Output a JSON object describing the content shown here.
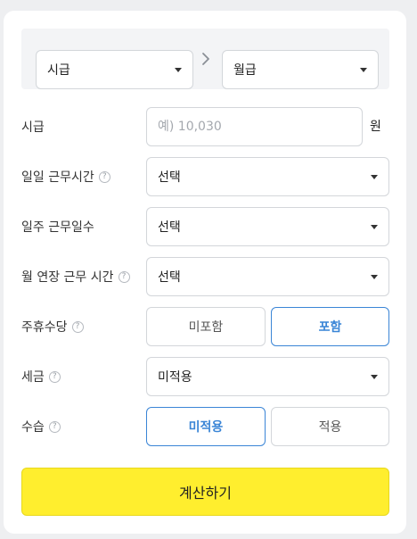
{
  "converter": {
    "from_unit": "시급",
    "to_unit": "월급",
    "arrow_icon": "chevron-right-icon"
  },
  "fields": {
    "hourly_wage": {
      "label": "시급",
      "placeholder": "예) 10,030",
      "value": "",
      "unit": "원"
    },
    "daily_hours": {
      "label": "일일 근무시간",
      "help": "?",
      "selected": "선택"
    },
    "weekly_days": {
      "label": "일주 근무일수",
      "selected": "선택"
    },
    "overtime_hours": {
      "label": "월 연장 근무 시간",
      "help": "?",
      "selected": "선택"
    },
    "holiday_allowance": {
      "label": "주휴수당",
      "help": "?",
      "options": [
        "미포함",
        "포함"
      ],
      "selected": "포함"
    },
    "tax": {
      "label": "세금",
      "help": "?",
      "selected": "미적용"
    },
    "probation": {
      "label": "수습",
      "help": "?",
      "options": [
        "미적용",
        "적용"
      ],
      "selected": "미적용"
    }
  },
  "submit_label": "계산하기",
  "colors": {
    "accent": "#3a85d6",
    "submit_bg": "#ffee2e",
    "panel_bg": "#f3f4f6"
  }
}
